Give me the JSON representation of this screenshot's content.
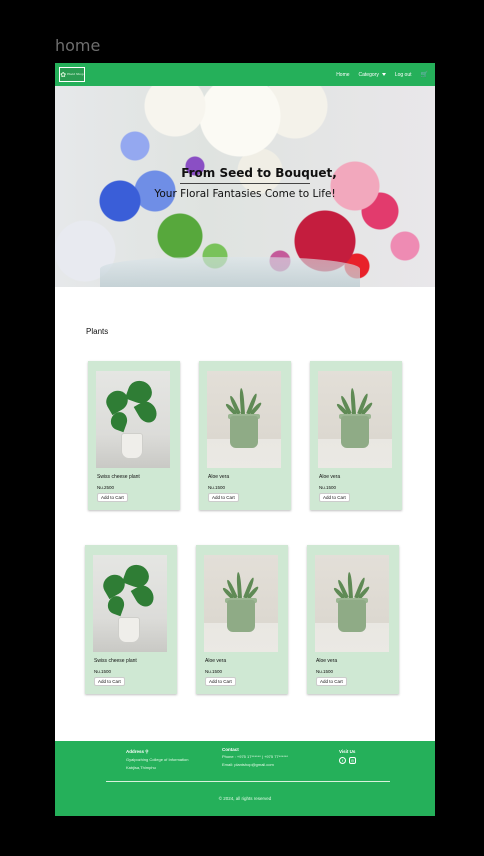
{
  "frame": {
    "title": "home"
  },
  "navbar": {
    "logo_mark": "✿",
    "logo_text": "Plant Shop",
    "links": {
      "home": "Home",
      "category": "Category",
      "logout": "Log out"
    },
    "cart_icon": "🛒"
  },
  "hero": {
    "title": "From Seed to Bouquet,",
    "subtitle": "Your Floral Fantasies Come to Life!"
  },
  "section": {
    "title": "Plants"
  },
  "products": [
    {
      "name": "Swiss cheese plant",
      "price": "Nu.2500",
      "button": "Add to Cart",
      "image": "monstera"
    },
    {
      "name": "Aloe vera",
      "price": "Nu.1500",
      "button": "Add to Cart",
      "image": "aloe"
    },
    {
      "name": "Aloe vera",
      "price": "Nu.1500",
      "button": "Add to Cart",
      "image": "aloe"
    },
    {
      "name": "Swiss cheese plant",
      "price": "Nu.1500",
      "button": "Add to Cart",
      "image": "monstera"
    },
    {
      "name": "Aloe vera",
      "price": "Nu.1500",
      "button": "Add to Cart",
      "image": "aloe"
    },
    {
      "name": "Aloe vera",
      "price": "Nu.1500",
      "button": "Add to Cart",
      "image": "aloe"
    }
  ],
  "footer": {
    "address": {
      "heading": "Address",
      "icon": "map-pin-icon",
      "line1": "Gyalpozhing College of Information",
      "line2": "Kabjisa,Thimphu"
    },
    "contact": {
      "heading": "Contact",
      "phone": "Phone : +975 17****** | +975 77******",
      "email": "Email: plantshop@gmail.com"
    },
    "visit": {
      "heading": "Visit Us",
      "facebook": "f",
      "instagram": "◎"
    },
    "copyright": "© 2024, all rights reserved"
  },
  "colors": {
    "brand_green": "#25b05a",
    "card_bg": "#cfe8d3"
  }
}
